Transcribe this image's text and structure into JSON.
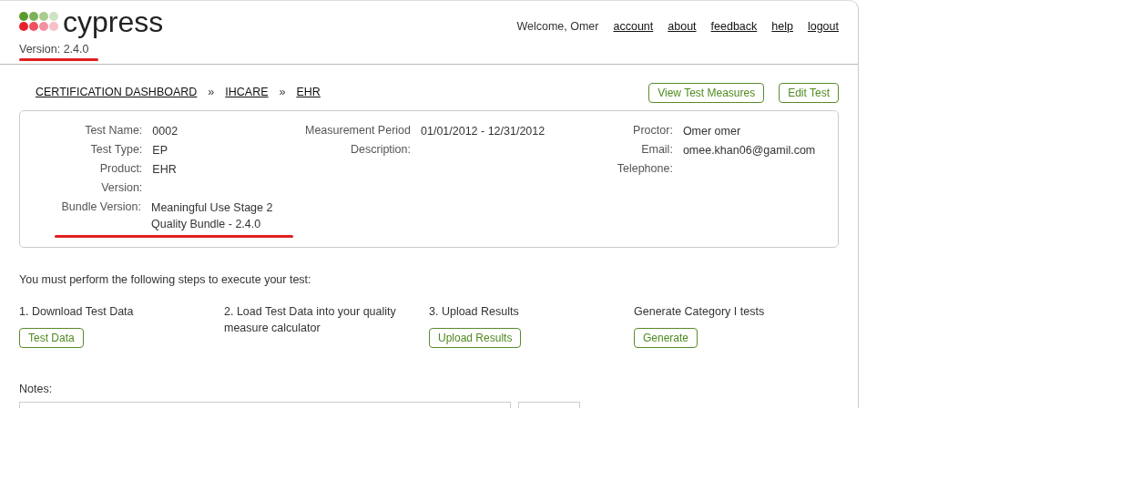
{
  "header": {
    "logo": "cypress",
    "version": "Version: 2.4.0",
    "welcome": "Welcome, Omer",
    "links": [
      "account",
      "about",
      "feedback",
      "help",
      "logout"
    ]
  },
  "breadcrumb": [
    "CERTIFICATION DASHBOARD",
    "IHCARE",
    "EHR"
  ],
  "breadcrumb_separator": "»",
  "actions": [
    "View Test Measures",
    "Edit Test"
  ],
  "details": [
    [
      {
        "label": "Test Name:",
        "value": "0002"
      },
      {
        "label": "Test Type:",
        "value": "EP"
      },
      {
        "label": "Product:",
        "value": "EHR"
      },
      {
        "label": "Version:"
      },
      {
        "label": "Bundle Version:",
        "value": "Meaningful Use Stage 2 Quality Bundle - 2.4.0"
      }
    ],
    [
      {
        "label": "Measurement Period",
        "value": "01/01/2012 - 12/31/2012"
      },
      {
        "label": "Description:"
      }
    ],
    [
      {
        "label": "Proctor:",
        "value": "Omer omer"
      },
      {
        "label": "Email:",
        "value": "omee.khan06@gamil.com"
      },
      {
        "label": "Telephone:"
      }
    ]
  ],
  "instructions": "You must perform the following steps to execute your test:",
  "steps": [
    {
      "text": "1. Download Test Data",
      "button": "Test Data"
    },
    {
      "text": "2. Load Test Data into your quality measure calculator"
    },
    {
      "text": "3. Upload Results",
      "button": "Upload Results"
    },
    {
      "text": "Generate Category I tests",
      "button": "Generate"
    }
  ],
  "notes": {
    "label": "Notes:"
  }
}
